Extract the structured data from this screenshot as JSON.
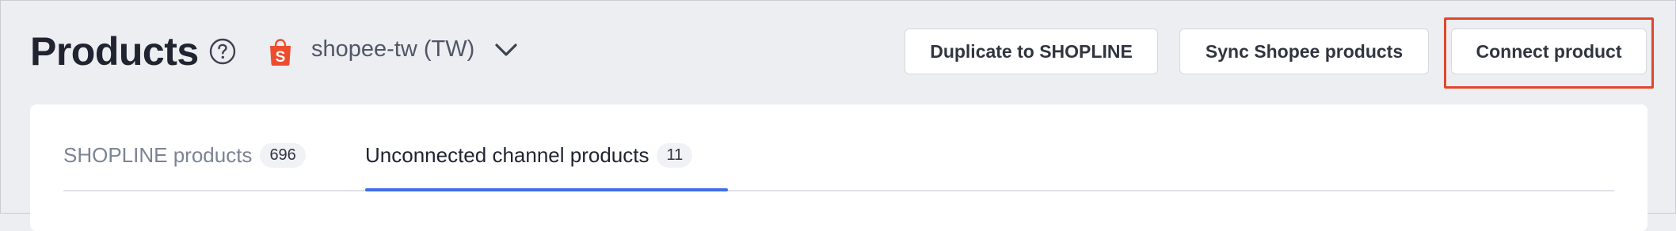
{
  "header": {
    "title": "Products",
    "shop_name": "shopee-tw (TW)",
    "buttons": {
      "duplicate": "Duplicate to SHOPLINE",
      "sync": "Sync Shopee products",
      "connect": "Connect product"
    }
  },
  "tabs": [
    {
      "label": "SHOPLINE products",
      "count": "696",
      "active": false
    },
    {
      "label": "Unconnected channel products",
      "count": "11",
      "active": true
    }
  ],
  "icons": {
    "help": "help-circle-icon",
    "shop": "shopee-bag-icon",
    "dropdown": "chevron-down-icon"
  },
  "colors": {
    "highlight": "#e2462b",
    "active_tab": "#3f6ee8",
    "shopee_orange": "#ee4d2d"
  }
}
